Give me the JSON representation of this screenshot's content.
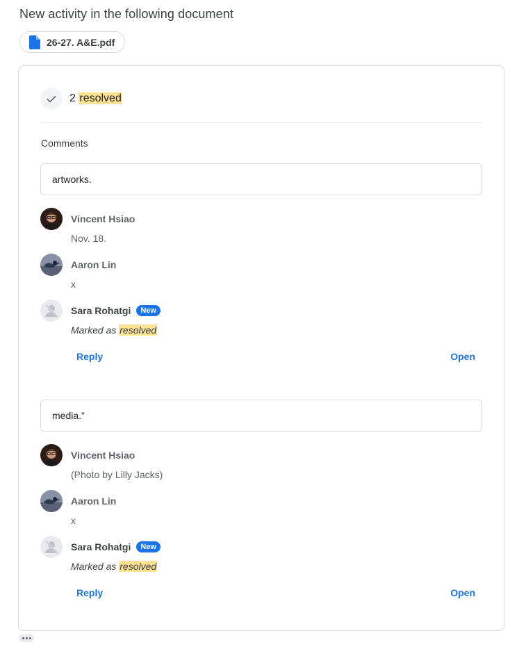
{
  "headline": "New activity in the following document",
  "file": {
    "name": "26-27. A&E.pdf",
    "icon": "doc-icon",
    "color": "#1a73e8"
  },
  "summary": {
    "count": "2",
    "label": "resolved"
  },
  "section_label": "Comments",
  "threads": [
    {
      "quote": "artworks.",
      "entries": [
        {
          "author": "Vincent Hsiao",
          "text": "Nov. 18.",
          "avatar": "person-photo"
        },
        {
          "author": "Aaron Lin",
          "text": "x",
          "avatar": "bird-photo"
        },
        {
          "author": "Sara Rohatgi",
          "badge": "New",
          "text_prefix": "Marked as",
          "text_highlight": "resolved",
          "avatar": "placeholder"
        }
      ],
      "reply_label": "Reply",
      "open_label": "Open"
    },
    {
      "quote": "media.”",
      "entries": [
        {
          "author": "Vincent Hsiao",
          "text": "(Photo by Lilly Jacks)",
          "avatar": "person-photo"
        },
        {
          "author": "Aaron Lin",
          "text": "x",
          "avatar": "bird-photo"
        },
        {
          "author": "Sara Rohatgi",
          "badge": "New",
          "text_prefix": "Marked as",
          "text_highlight": "resolved",
          "avatar": "placeholder"
        }
      ],
      "reply_label": "Reply",
      "open_label": "Open"
    }
  ],
  "colors": {
    "accent": "#1a73e8",
    "highlight": "#fde293",
    "border": "#dadce0"
  }
}
